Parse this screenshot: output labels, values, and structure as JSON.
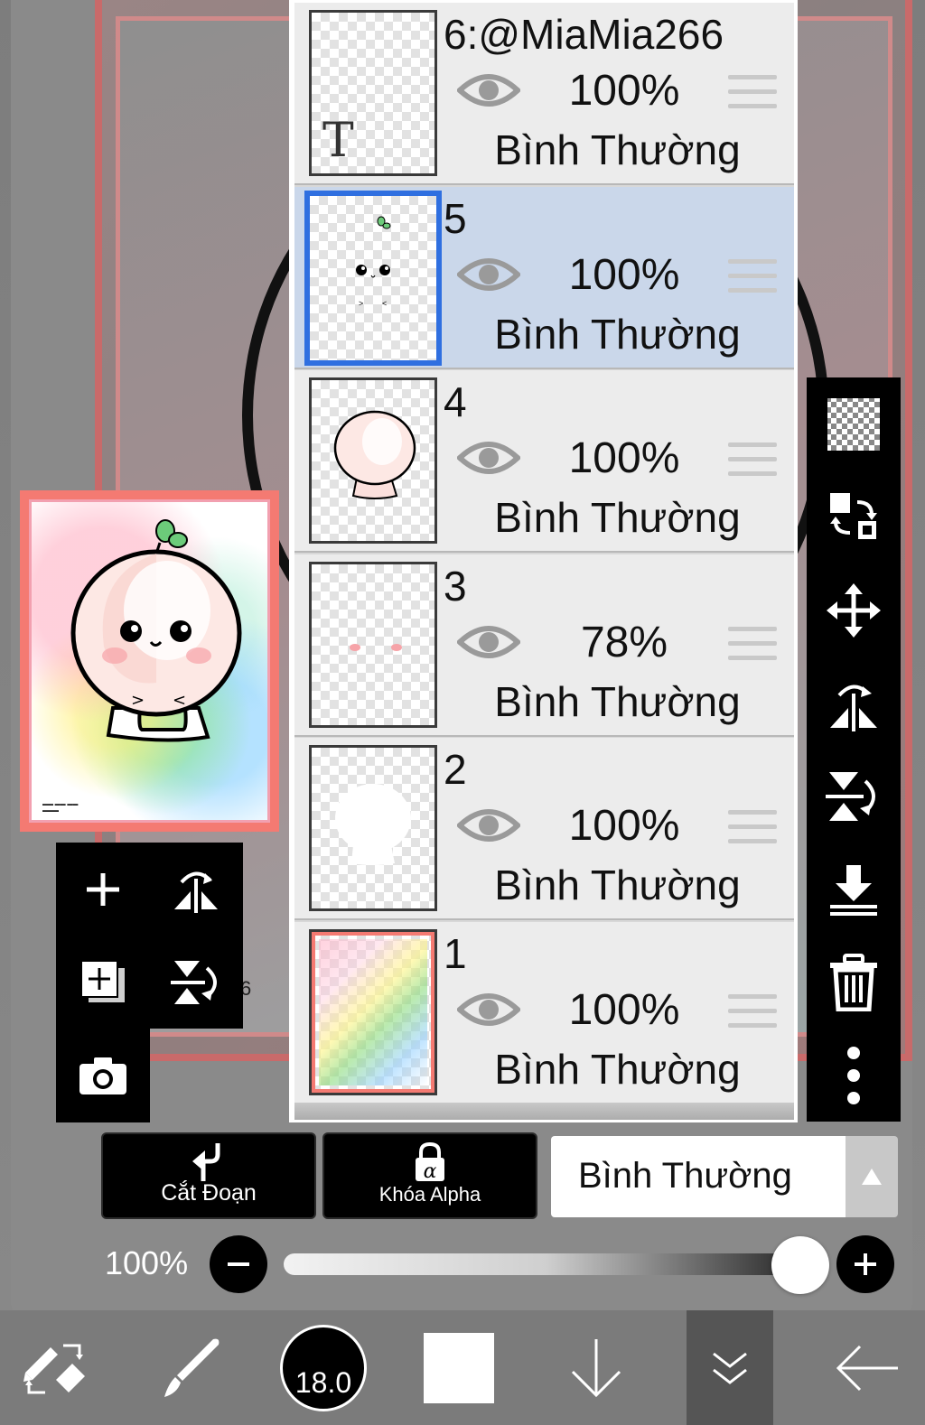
{
  "layers": [
    {
      "name": "6:@MiaMia266",
      "opacity": "100%",
      "blend": "Bình Thường",
      "thumb": "text-layer",
      "thumb_glyph": "T",
      "selected": false
    },
    {
      "name": "5",
      "opacity": "100%",
      "blend": "Bình Thường",
      "thumb": "face-layer",
      "selected": true
    },
    {
      "name": "4",
      "opacity": "100%",
      "blend": "Bình Thường",
      "thumb": "body-outline-layer",
      "selected": false
    },
    {
      "name": "3",
      "opacity": "78%",
      "blend": "Bình Thường",
      "thumb": "blush-layer",
      "selected": false
    },
    {
      "name": "2",
      "opacity": "100%",
      "blend": "Bình Thường",
      "thumb": "white-fill-layer",
      "selected": false
    },
    {
      "name": "1",
      "opacity": "100%",
      "blend": "Bình Thường",
      "thumb": "rainbow-background-layer",
      "selected": false
    }
  ],
  "controls": {
    "clipping_label": "Cắt Đoạn",
    "alpha_lock_label": "Khóa Alpha",
    "blend_mode_value": "Bình Thường"
  },
  "opacity_slider": {
    "label": "100%",
    "value": 1.0
  },
  "brush": {
    "size_label": "18.0"
  },
  "canvas": {
    "stray_mark": "6"
  },
  "colors": {
    "panel_bg": "#ececec",
    "selected_row": "#cad7ea",
    "selection_border": "#2f6fe0",
    "preview_frame": "#f47a72",
    "current_color": "#ffffff"
  },
  "icons": {
    "left_tools": [
      "add-layer-icon",
      "flip-horizontal-icon",
      "add-copy-layer-icon",
      "flip-vertical-icon",
      "camera-icon"
    ],
    "right_tools": [
      "transparency-checker-icon",
      "swap-layers-icon",
      "move-icon",
      "flip-horizontal-icon",
      "flip-vertical-icon",
      "merge-down-icon",
      "trash-icon",
      "more-vertical-icon"
    ],
    "bottom_bar": [
      "tool-switch-icon",
      "brush-icon",
      "brush-size-indicator",
      "color-swatch",
      "arrow-down-icon",
      "chevron-double-down-icon",
      "back-arrow-icon"
    ]
  }
}
